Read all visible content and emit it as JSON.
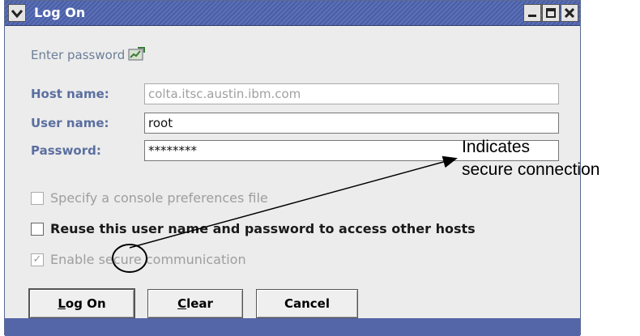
{
  "window": {
    "title": "Log On",
    "titlebar_buttons": [
      "minimize-icon",
      "maximize-icon",
      "close-icon"
    ]
  },
  "prompt": {
    "text": "Enter password",
    "icon": "secure-connection-icon"
  },
  "fields": {
    "host": {
      "label": "Host name:",
      "value": "colta.itsc.austin.ibm.com"
    },
    "user": {
      "label": "User name:",
      "value": "root"
    },
    "password": {
      "label": "Password:",
      "value": "********"
    }
  },
  "options": {
    "console_prefs": {
      "label": "Specify a console preferences file",
      "checked": false,
      "enabled": false
    },
    "reuse": {
      "label": "Reuse this user name and password to access other hosts",
      "checked": false,
      "enabled": true
    },
    "secure": {
      "label": "Enable secure communication",
      "checked": true,
      "enabled": false
    }
  },
  "buttons": {
    "logon": {
      "label": "Log On",
      "mnemonic": "L",
      "rest": "og On"
    },
    "clear": {
      "label": "Clear",
      "mnemonic": "C",
      "rest": "lear"
    },
    "cancel": {
      "label": "Cancel"
    }
  },
  "annotation": {
    "line1": "Indicates",
    "line2": "secure connection"
  },
  "colors": {
    "titlebar": "#4a5ea4",
    "label": "#5b6fa0",
    "disabled_text": "#9e9e9e"
  }
}
